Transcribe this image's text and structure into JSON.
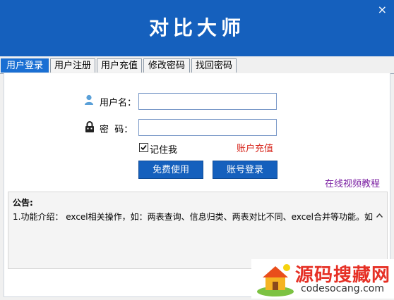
{
  "header": {
    "title": "对比大师",
    "close_glyph": "×"
  },
  "tabs": [
    {
      "label": "用户登录",
      "active": true
    },
    {
      "label": "用户注册",
      "active": false
    },
    {
      "label": "用户充值",
      "active": false
    },
    {
      "label": "修改密码",
      "active": false
    },
    {
      "label": "找回密码",
      "active": false
    }
  ],
  "form": {
    "username_label": "用户名：",
    "password_label": "密  码：",
    "username_value": "",
    "password_value": "",
    "remember_label": "记住我",
    "remember_checked": true,
    "recharge_link": "账户充值",
    "free_button": "免费使用",
    "login_button": "账号登录",
    "video_link": "在线视频教程"
  },
  "notice": {
    "title": "公告:",
    "text": "1.功能介绍： excel相关操作，如：两表查询、信息归类、两表对比不同、excel合并等功能。如"
  },
  "watermark": {
    "brand": "源码搜藏网",
    "url": "codesocang.com"
  },
  "colors": {
    "header": "#1560bd",
    "tab_active": "#1a6fd3",
    "link_red": "#d7261c",
    "link_purple": "#7b1fa2"
  },
  "icons": {
    "user": "user-icon",
    "lock": "lock-icon",
    "scroll": "chevron-up-icon"
  }
}
